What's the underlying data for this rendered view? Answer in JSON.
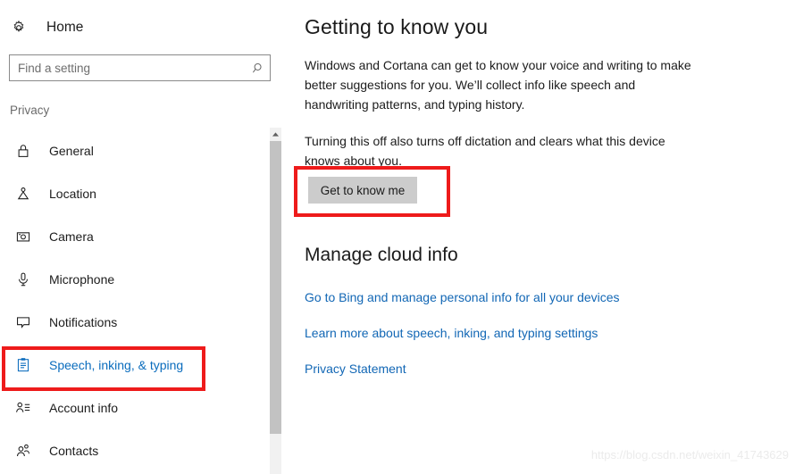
{
  "sidebar": {
    "home": {
      "label": "Home",
      "icon": "gear-icon"
    },
    "search": {
      "value": "",
      "placeholder": "Find a setting",
      "icon": "search-icon"
    },
    "section_label": "Privacy",
    "items": [
      {
        "label": "General",
        "icon": "lock-icon",
        "selected": false
      },
      {
        "label": "Location",
        "icon": "location-pin-icon",
        "selected": false
      },
      {
        "label": "Camera",
        "icon": "camera-icon",
        "selected": false
      },
      {
        "label": "Microphone",
        "icon": "microphone-icon",
        "selected": false
      },
      {
        "label": "Notifications",
        "icon": "notification-icon",
        "selected": false
      },
      {
        "label": "Speech, inking, & typing",
        "icon": "clipboard-icon",
        "selected": true
      },
      {
        "label": "Account info",
        "icon": "account-info-icon",
        "selected": false
      },
      {
        "label": "Contacts",
        "icon": "contacts-icon",
        "selected": false
      }
    ],
    "scrollbar": {
      "up_arrow": "▲"
    }
  },
  "main": {
    "heading": "Getting to know you",
    "paragraph1": "Windows and Cortana can get to know your voice and writing to make better suggestions for you. We’ll collect info like speech and handwriting patterns, and typing history.",
    "paragraph2": "Turning this off also turns off dictation and clears what this device knows about you.",
    "button_label": "Get to know me",
    "section_heading": "Manage cloud info",
    "links": [
      "Go to Bing and manage personal info for all your devices",
      "Learn more about speech, inking, and typing settings",
      "Privacy Statement"
    ]
  },
  "watermark": "https://blog.csdn.net/weixin_41743629",
  "colors": {
    "accent_link": "#1267b5",
    "selected_nav": "#0a6cbd",
    "highlight_box": "#ee1b1b",
    "button_bg": "#cccccc"
  }
}
